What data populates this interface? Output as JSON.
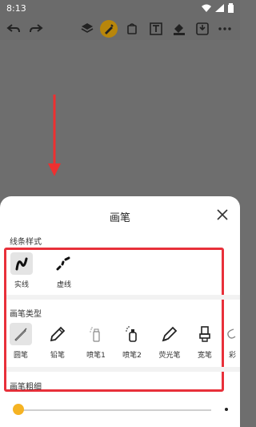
{
  "status_bar": {
    "time": "8:13"
  },
  "toolbar": {
    "icons": [
      "undo-icon",
      "redo-icon",
      "layers-icon",
      "pen-icon",
      "bucket-icon",
      "text-icon",
      "fill-icon",
      "save-icon",
      "more-icon"
    ],
    "active_color": "#b8860b"
  },
  "sheet": {
    "title": "画笔",
    "sections": {
      "line_style": "线条样式",
      "brush_type": "画笔类型",
      "brush_size": "画笔粗细"
    },
    "line_styles": [
      {
        "label": "实线",
        "selected": true
      },
      {
        "label": "虚线",
        "selected": false
      }
    ],
    "brush_types": [
      {
        "label": "圆笔",
        "selected": true
      },
      {
        "label": "铅笔",
        "selected": false
      },
      {
        "label": "喷笔1",
        "selected": false
      },
      {
        "label": "喷笔2",
        "selected": false
      },
      {
        "label": "荧光笔",
        "selected": false
      },
      {
        "label": "宽笔",
        "selected": false
      },
      {
        "label": "彩",
        "selected": false
      }
    ],
    "brush_size_value": 0.02
  },
  "colors": {
    "slider_thumb": "#f5b323",
    "highlight": "#e8303a"
  }
}
